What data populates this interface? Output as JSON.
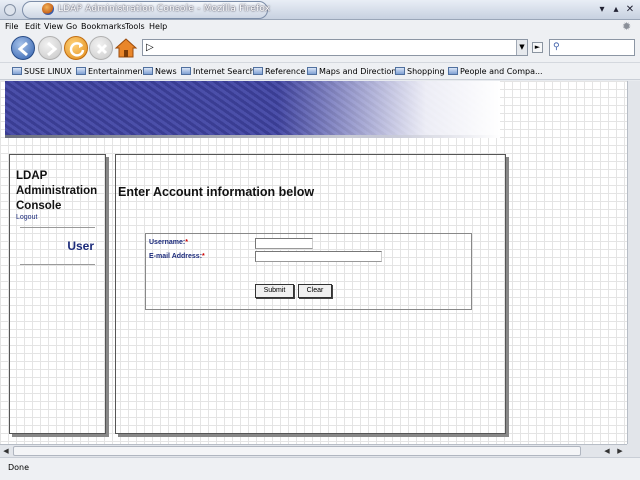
{
  "window": {
    "title": "LDAP Administration Console - Mozilla Firefox",
    "buttons": [
      "minimize-icon",
      "maximize-icon",
      "close-icon"
    ]
  },
  "menubar": {
    "items": [
      "File",
      "Edit",
      "View",
      "Go",
      "Bookmarks",
      "Tools",
      "Help"
    ]
  },
  "toolbar": {
    "url_value": "",
    "search_value": "",
    "icons": [
      "back-icon",
      "forward-icon",
      "reload-icon",
      "stop-icon",
      "home-icon",
      "go-icon",
      "search-icon"
    ]
  },
  "bookmarks": {
    "items": [
      "SUSE LINUX",
      "Entertainment",
      "News",
      "Internet Search",
      "Reference",
      "Maps and Directions",
      "Shopping",
      "People and Compa..."
    ]
  },
  "sidebar": {
    "app_title_line1": "LDAP",
    "app_title_line2": "Administration",
    "app_title_line3": "Console",
    "logout_label": "Logout",
    "user_label": "User"
  },
  "main": {
    "heading": "Enter Account information below",
    "form": {
      "username_label": "Username:",
      "username_required": "*",
      "username_value": "",
      "email_label": "E-mail Address:",
      "email_required": "*",
      "email_value": "",
      "submit_label": "Submit",
      "clear_label": "Clear"
    }
  },
  "statusbar": {
    "text": "Done"
  },
  "colors": {
    "link": "#1b2a7a",
    "banner": "#43479f",
    "required": "#cc0000"
  }
}
